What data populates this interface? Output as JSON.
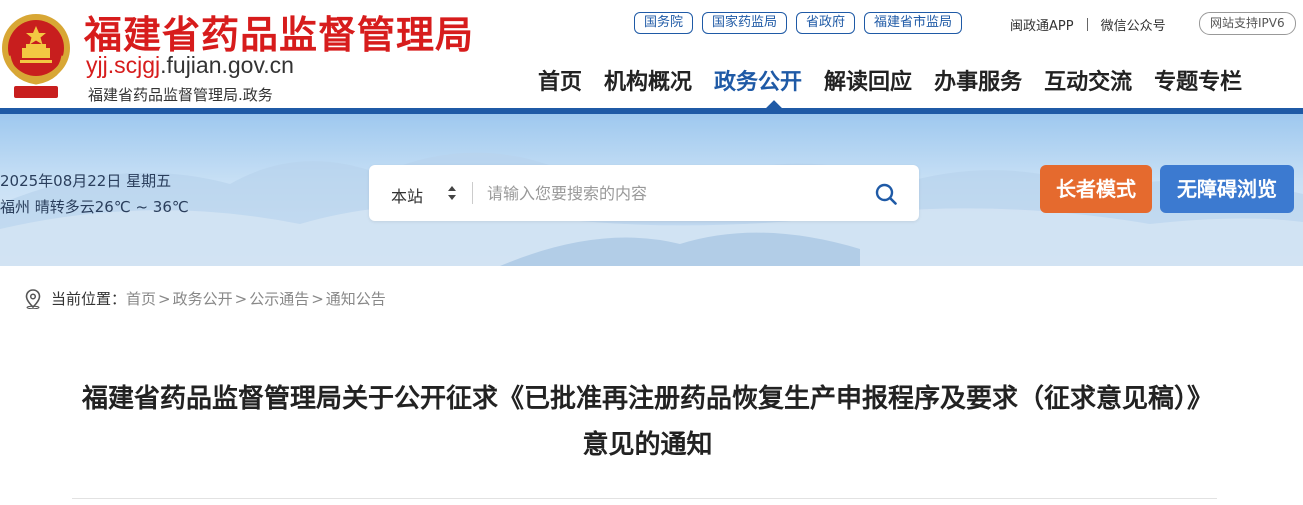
{
  "header": {
    "title": "福建省药品监督管理局",
    "domain_highlight": "yjj.scjgj",
    "domain_rest": ".fujian.gov.cn",
    "subtitle": "福建省药品监督管理局.政务",
    "toplinks": [
      "国务院",
      "国家药监局",
      "省政府",
      "福建省市监局"
    ],
    "app_link": "闽政通APP",
    "wechat_link": "微信公众号",
    "ipv6_badge": "网站支持IPV6",
    "nav": [
      {
        "label": "首页",
        "active": false
      },
      {
        "label": "机构概况",
        "active": false
      },
      {
        "label": "政务公开",
        "active": true
      },
      {
        "label": "解读回应",
        "active": false
      },
      {
        "label": "办事服务",
        "active": false
      },
      {
        "label": "互动交流",
        "active": false
      },
      {
        "label": "专题专栏",
        "active": false
      }
    ]
  },
  "banner": {
    "date": "2025年08月22日  星期五",
    "weather": "福州  晴转多云26℃ ~ 36℃",
    "search": {
      "scope": "本站",
      "placeholder": "请输入您要搜索的内容",
      "value": ""
    },
    "elder_mode": "长者模式",
    "accessibility": "无障碍浏览"
  },
  "breadcrumb": {
    "label": "当前位置：",
    "items": [
      "首页",
      "政务公开",
      "公示通告",
      "通知公告"
    ],
    "separator": ">"
  },
  "article": {
    "title": "福建省药品监督管理局关于公开征求《已批准再注册药品恢复生产申报程序及要求（征求意见稿）》意见的通知"
  },
  "colors": {
    "brand_red": "#d71c1c",
    "brand_blue": "#1f5aa6",
    "elder_orange": "#e56a2e",
    "access_blue": "#3c7ad0"
  },
  "icons": {
    "emblem": "national-emblem-icon",
    "search": "search-icon",
    "location": "location-pin-icon",
    "scope_toggle": "sort-arrows-icon"
  }
}
